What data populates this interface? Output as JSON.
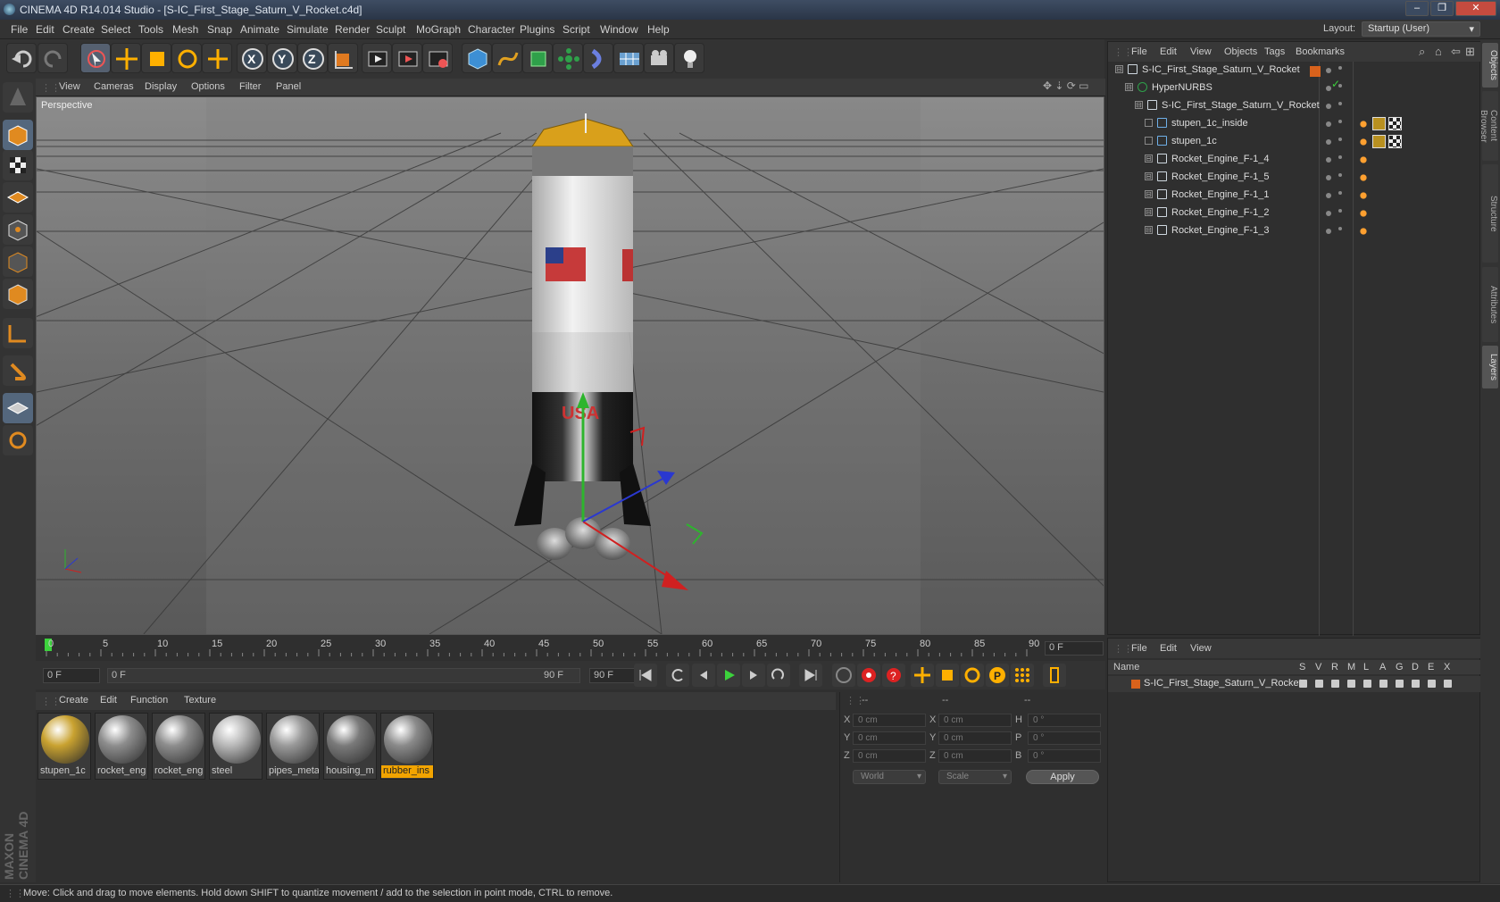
{
  "window": {
    "title": "CINEMA 4D R14.014 Studio - [S-IC_First_Stage_Saturn_V_Rocket.c4d]",
    "buttons": [
      "–",
      "❐",
      "✕"
    ]
  },
  "menubar": {
    "items": [
      "File",
      "Edit",
      "Create",
      "Select",
      "Tools",
      "Mesh",
      "Snap",
      "Animate",
      "Simulate",
      "Render",
      "Sculpt",
      "MoGraph",
      "Character",
      "Plugins",
      "Script",
      "Window",
      "Help"
    ],
    "layout_label": "Layout:",
    "layout_value": "Startup (User)"
  },
  "toolbar": {
    "icons": [
      "undo-icon",
      "redo-icon",
      "live-selection-icon",
      "move-icon",
      "scale-icon",
      "rotate-icon",
      "add-icon",
      "x-axis-icon",
      "y-axis-icon",
      "z-axis-icon",
      "coordinate-system-icon",
      "render-view-icon",
      "render-picture-viewer-icon",
      "render-settings-icon",
      "cube-icon",
      "spline-icon",
      "nurbs-icon",
      "array-icon",
      "deformer-icon",
      "environment-icon",
      "camera-icon",
      "light-icon"
    ]
  },
  "viewport": {
    "menu": [
      "View",
      "Cameras",
      "Display",
      "Options",
      "Filter",
      "Panel"
    ],
    "label": "Perspective",
    "decal_text": "USA"
  },
  "timeline": {
    "ticks": [
      "0",
      "5",
      "10",
      "15",
      "20",
      "25",
      "30",
      "35",
      "40",
      "45",
      "50",
      "55",
      "60",
      "65",
      "70",
      "75",
      "80",
      "85",
      "90"
    ],
    "current_frame": "0 F"
  },
  "transport": {
    "start_frame": "0 F",
    "range_start": "0 F",
    "range_end": "90 F",
    "end_frame": "90 F"
  },
  "materials": {
    "menu": [
      "Create",
      "Edit",
      "Function",
      "Texture"
    ],
    "items": [
      {
        "name": "stupen_1c",
        "color": "#c9a230"
      },
      {
        "name": "rocket_eng",
        "color": "#8d8d8d"
      },
      {
        "name": "rocket_eng",
        "color": "#8d8d8d"
      },
      {
        "name": "steel",
        "color": "#b8b8b8"
      },
      {
        "name": "pipes_meta",
        "color": "#9a9a9a"
      },
      {
        "name": "housing_m",
        "color": "#7a7a7a"
      },
      {
        "name": "rubber_ins",
        "color": "#8a8a8a"
      }
    ],
    "selected_index": 6
  },
  "coordinates": {
    "headers": [
      "--",
      "--",
      "--"
    ],
    "rows": [
      {
        "a": "X",
        "av": "0 cm",
        "b": "X",
        "bv": "0 cm",
        "c": "H",
        "cv": "0 °"
      },
      {
        "a": "Y",
        "av": "0 cm",
        "b": "Y",
        "bv": "0 cm",
        "c": "P",
        "cv": "0 °"
      },
      {
        "a": "Z",
        "av": "0 cm",
        "b": "Z",
        "bv": "0 cm",
        "c": "B",
        "cv": "0 °"
      }
    ],
    "mode_world": "World",
    "mode_scale": "Scale",
    "apply": "Apply"
  },
  "objects": {
    "menu": [
      "File",
      "Edit",
      "View",
      "Objects",
      "Tags",
      "Bookmarks"
    ],
    "tree": [
      {
        "name": "S-IC_First_Stage_Saturn_V_Rocket",
        "level": 0,
        "icon": "null"
      },
      {
        "name": "HyperNURBS",
        "level": 1,
        "icon": "nurbs"
      },
      {
        "name": "S-IC_First_Stage_Saturn_V_Rocket",
        "level": 2,
        "icon": "null"
      },
      {
        "name": "stupen_1c_inside",
        "level": 3,
        "icon": "poly"
      },
      {
        "name": "stupen_1c",
        "level": 3,
        "icon": "poly"
      },
      {
        "name": "Rocket_Engine_F-1_4",
        "level": 3,
        "icon": "null"
      },
      {
        "name": "Rocket_Engine_F-1_5",
        "level": 3,
        "icon": "null"
      },
      {
        "name": "Rocket_Engine_F-1_1",
        "level": 3,
        "icon": "null"
      },
      {
        "name": "Rocket_Engine_F-1_2",
        "level": 3,
        "icon": "null"
      },
      {
        "name": "Rocket_Engine_F-1_3",
        "level": 3,
        "icon": "null"
      }
    ]
  },
  "layers": {
    "menu": [
      "File",
      "Edit",
      "View"
    ],
    "name_header": "Name",
    "columns": [
      "S",
      "V",
      "R",
      "M",
      "L",
      "A",
      "G",
      "D",
      "E",
      "X"
    ],
    "row_name": "S-IC_First_Stage_Saturn_V_Rocket",
    "row_color": "#d8621c"
  },
  "right_tabs": [
    "Objects",
    "Content Browser",
    "Structure",
    "Attributes",
    "Layers"
  ],
  "branding": "MAXON CINEMA 4D",
  "status": "Move: Click and drag to move elements. Hold down SHIFT to quantize movement / add to the selection in point mode, CTRL to remove."
}
